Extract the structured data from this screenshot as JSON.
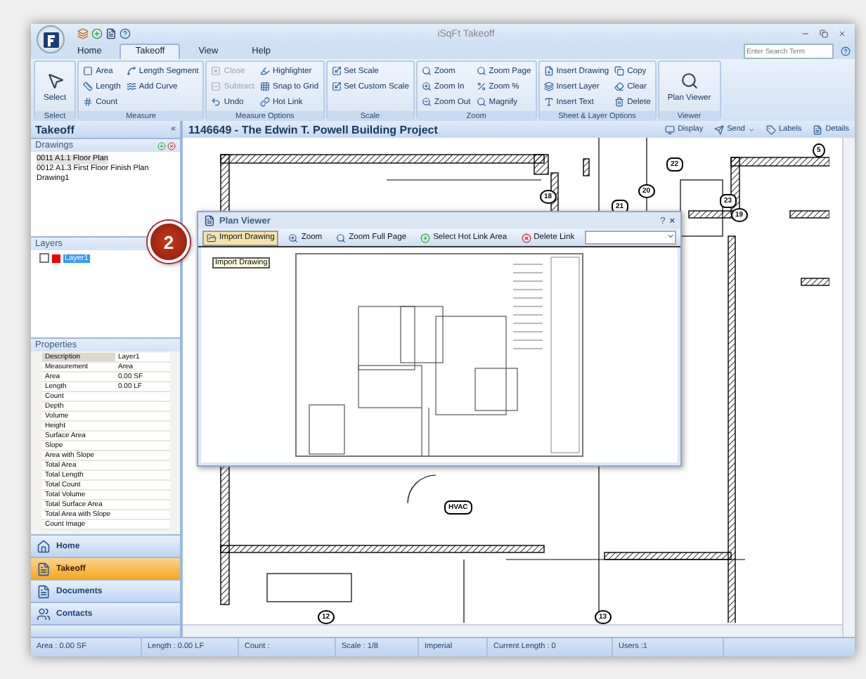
{
  "app": {
    "title": "iSqFt Takeoff",
    "search_placeholder": "Enter Search Term"
  },
  "tabs": [
    {
      "label": "Home",
      "selected": false
    },
    {
      "label": "Takeoff",
      "selected": true
    },
    {
      "label": "View",
      "selected": false
    },
    {
      "label": "Help",
      "selected": false
    }
  ],
  "ribbon": [
    {
      "label": "Select",
      "large": [
        {
          "label": "Select"
        }
      ]
    },
    {
      "label": "Measure",
      "items": [
        {
          "label": "Area",
          "disabled": false
        },
        {
          "label": "Length",
          "disabled": false
        },
        {
          "label": "Count",
          "disabled": false
        },
        {
          "label": "Length Segment",
          "disabled": false
        },
        {
          "label": "Add Curve",
          "disabled": false
        }
      ]
    },
    {
      "label": "Measure Options",
      "items": [
        {
          "label": "Close",
          "disabled": true
        },
        {
          "label": "Subtract",
          "disabled": true
        },
        {
          "label": "Undo",
          "disabled": false
        },
        {
          "label": "Highlighter",
          "disabled": false
        },
        {
          "label": "Snap to Grid",
          "disabled": false
        },
        {
          "label": "Hot Link",
          "disabled": false
        }
      ]
    },
    {
      "label": "Scale",
      "items": [
        {
          "label": "Set Scale",
          "disabled": false
        },
        {
          "label": "Set Custom Scale",
          "disabled": false
        }
      ]
    },
    {
      "label": "Zoom",
      "items": [
        {
          "label": "Zoom",
          "disabled": false
        },
        {
          "label": "Zoom In",
          "disabled": false
        },
        {
          "label": "Zoom Out",
          "disabled": false
        },
        {
          "label": "Zoom Page",
          "disabled": false
        },
        {
          "label": "Zoom %",
          "disabled": false
        },
        {
          "label": "Magnify",
          "disabled": false
        }
      ]
    },
    {
      "label": "Sheet & Layer Options",
      "items": [
        {
          "label": "Insert Drawing",
          "disabled": false
        },
        {
          "label": "Insert Layer",
          "disabled": false
        },
        {
          "label": "Insert Text",
          "disabled": false
        },
        {
          "label": "Copy",
          "disabled": false
        },
        {
          "label": "Clear",
          "disabled": false
        },
        {
          "label": "Delete",
          "disabled": false
        }
      ]
    },
    {
      "label": "Viewer",
      "large": [
        {
          "label": "Plan Viewer"
        }
      ]
    }
  ],
  "panel": {
    "title": "Takeoff",
    "collapse": "«",
    "drawings": {
      "title": "Drawings",
      "items": [
        {
          "label": "0011 A1.1 Floor Plan",
          "selected": true
        },
        {
          "label": "0012 A1.3 First Floor Finish Plan",
          "selected": false
        },
        {
          "label": "Drawing1",
          "selected": false
        }
      ]
    },
    "layers": {
      "title": "Layers",
      "items": [
        {
          "label": "Layer1",
          "checked": false,
          "selected": true,
          "color": "#ee0000"
        }
      ]
    },
    "properties": {
      "title": "Properties",
      "rows": [
        {
          "name": "Description",
          "value": "Layer1"
        },
        {
          "name": "Measurement",
          "value": "Area"
        },
        {
          "name": "Area",
          "value": "0.00 SF"
        },
        {
          "name": "Length",
          "value": "0.00 LF"
        },
        {
          "name": "Count",
          "value": ""
        },
        {
          "name": "Depth",
          "value": ""
        },
        {
          "name": "Volume",
          "value": ""
        },
        {
          "name": "Height",
          "value": ""
        },
        {
          "name": "Surface Area",
          "value": ""
        },
        {
          "name": "Slope",
          "value": ""
        },
        {
          "name": "Area with Slope",
          "value": ""
        },
        {
          "name": "Total Area",
          "value": ""
        },
        {
          "name": "Total Length",
          "value": ""
        },
        {
          "name": "Total Count",
          "value": ""
        },
        {
          "name": "Total Volume",
          "value": ""
        },
        {
          "name": "Total Surface Area",
          "value": ""
        },
        {
          "name": "Total Area with Slope",
          "value": ""
        },
        {
          "name": "Count Image",
          "value": ""
        }
      ]
    },
    "nav": [
      {
        "label": "Home",
        "selected": false
      },
      {
        "label": "Takeoff",
        "selected": true
      },
      {
        "label": "Documents",
        "selected": false
      },
      {
        "label": "Contacts",
        "selected": false
      }
    ]
  },
  "document": {
    "title": "1146649 - The Edwin T. Powell Building Project",
    "actions": [
      {
        "label": "Display",
        "dropdown": false
      },
      {
        "label": "Send",
        "dropdown": true
      },
      {
        "label": "Labels",
        "dropdown": false
      },
      {
        "label": "Details",
        "dropdown": false
      }
    ],
    "plan_tags": [
      "5",
      "22",
      "18",
      "20",
      "21",
      "23",
      "19",
      "HVAC",
      "12",
      "13"
    ]
  },
  "plan_viewer": {
    "title": "Plan Viewer",
    "help": "?",
    "close": "×",
    "tools": [
      "Import Drawing",
      "Zoom",
      "Zoom Full Page",
      "Select Hot Link Area",
      "Delete Link"
    ],
    "tooltip": "Import Drawing"
  },
  "callout": "2",
  "status_bar": [
    "Area : 0.00 SF",
    "Length : 0.00 LF",
    "Count :",
    "Scale : 1/8",
    "Imperial",
    "Current Length : 0",
    "Users :1"
  ]
}
